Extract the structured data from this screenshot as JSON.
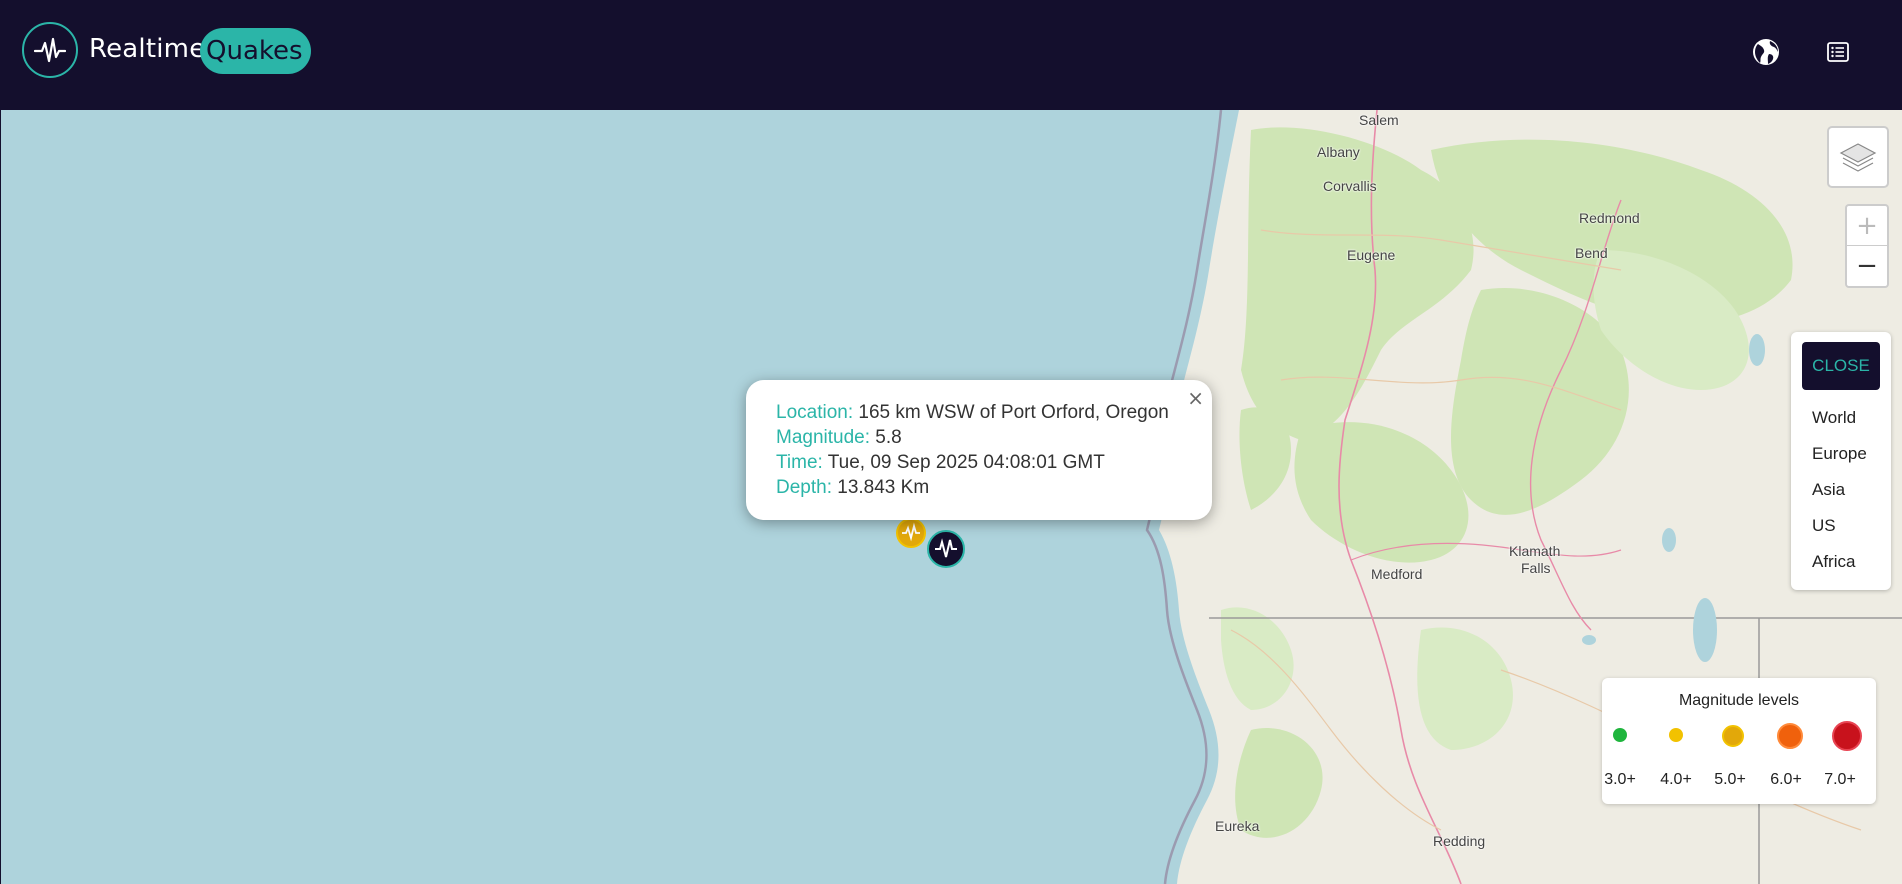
{
  "brand": {
    "name_part1": "Realtime",
    "name_part2": "Quakes"
  },
  "nav": {
    "globe_icon": "globe-icon",
    "list_icon": "list-icon"
  },
  "map": {
    "cities": {
      "salem": "Salem",
      "albany": "Albany",
      "corvallis": "Corvallis",
      "eugene": "Eugene",
      "redmond": "Redmond",
      "bend": "Bend",
      "medford": "Medford",
      "klamath1": "Klamath",
      "klamath2": "Falls",
      "eureka": "Eureka",
      "redding": "Redding"
    },
    "zoom": {
      "in": "+",
      "out": "−"
    }
  },
  "popup": {
    "location_label": "Location:",
    "location_value": "165 km WSW of Port Orford, Oregon",
    "magnitude_label": "Magnitude:",
    "magnitude_value": "5.8",
    "time_label": "Time:",
    "time_value": "Tue, 09 Sep 2025 04:08:01 GMT",
    "depth_label": "Depth:",
    "depth_value": "13.843 Km",
    "close": "×"
  },
  "regions": {
    "close_label": "CLOSE",
    "items": [
      "World",
      "Europe",
      "Asia",
      "US",
      "Africa"
    ]
  },
  "legend": {
    "title": "Magnitude levels",
    "levels": [
      {
        "label": "3.0+",
        "color": "#1fb53d"
      },
      {
        "label": "4.0+",
        "color": "#f2c200"
      },
      {
        "label": "5.0+",
        "color": "#e2a80a"
      },
      {
        "label": "6.0+",
        "color": "#f0610c"
      },
      {
        "label": "7.0+",
        "color": "#c8121c"
      }
    ]
  },
  "colors": {
    "header": "#140f2d",
    "accent": "#2bb5a8",
    "ocean": "#aed3dc",
    "land": "#eeece3",
    "forest": "#cfe5b5"
  }
}
